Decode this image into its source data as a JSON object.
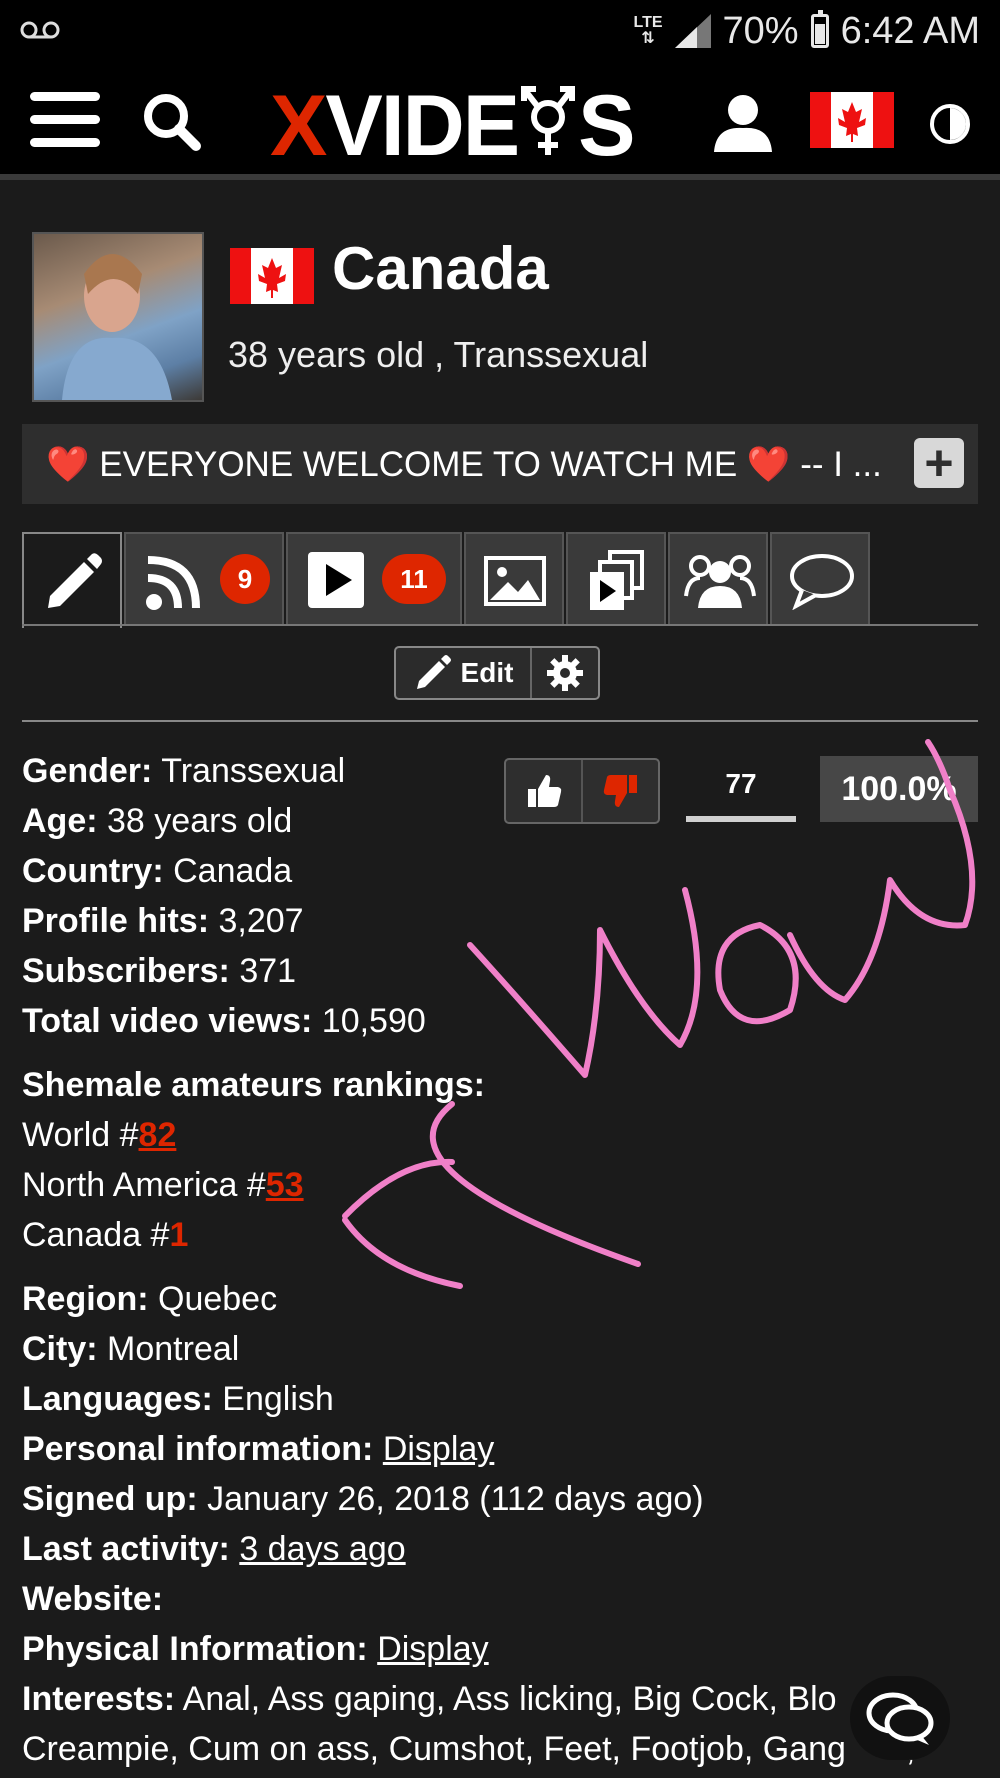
{
  "status_bar": {
    "network": "LTE",
    "battery": "70%",
    "battery_level": 0.7,
    "time": "6:42 AM"
  },
  "header": {
    "logo_x": "X",
    "logo_rest_1": "VIDE",
    "logo_rest_2": "S"
  },
  "profile": {
    "name": "Canada",
    "subtitle": "38 years old , Transsexual",
    "bio": "❤️ EVERYONE WELCOME TO WATCH ME ❤️ -- I ...",
    "expand_label": "+"
  },
  "tabs": [
    {
      "icon": "pencil-icon"
    },
    {
      "icon": "rss-icon",
      "badge": "9"
    },
    {
      "icon": "play-icon",
      "badge": "11"
    },
    {
      "icon": "image-icon"
    },
    {
      "icon": "playlist-icon"
    },
    {
      "icon": "friends-icon"
    },
    {
      "icon": "chat-bubble-icon"
    }
  ],
  "edit": {
    "label": "Edit"
  },
  "votes": {
    "count": "77",
    "percent": "100.0%"
  },
  "details": {
    "gender_label": "Gender:",
    "gender": "Transsexual",
    "age_label": "Age:",
    "age": "38 years old",
    "country_label": "Country:",
    "country": "Canada",
    "hits_label": "Profile hits:",
    "hits": "3,207",
    "subs_label": "Subscribers:",
    "subs": "371",
    "views_label": "Total video views:",
    "views": "10,590",
    "rankings_label": "Shemale amateurs rankings:",
    "world_prefix": "World #",
    "world_rank": "82",
    "na_prefix": "North America #",
    "na_rank": "53",
    "canada_prefix": "Canada #",
    "canada_rank": "1",
    "region_label": "Region:",
    "region": "Quebec",
    "city_label": "City:",
    "city": "Montreal",
    "languages_label": "Languages:",
    "languages": "English",
    "personal_label": "Personal information:",
    "personal_link": "Display",
    "signed_label": "Signed up:",
    "signed": "January 26, 2018 (112 days ago)",
    "activity_label": "Last activity:",
    "activity_link": "3 days ago",
    "website_label": "Website:",
    "physical_label": "Physical Information:",
    "physical_link": "Display",
    "interests_label": "Interests:",
    "interests_line1": "Anal, Ass gaping, Ass licking, Big Cock, Blo",
    "interests_line1_tail": ",",
    "interests_line2": "Creampie, Cum on ass, Cumshot, Feet, Footjob, Gang",
    "interests_line2_tail": ","
  },
  "colors": {
    "accent": "#de2600",
    "background": "#1b1b1b",
    "annotation": "#f080c8"
  }
}
